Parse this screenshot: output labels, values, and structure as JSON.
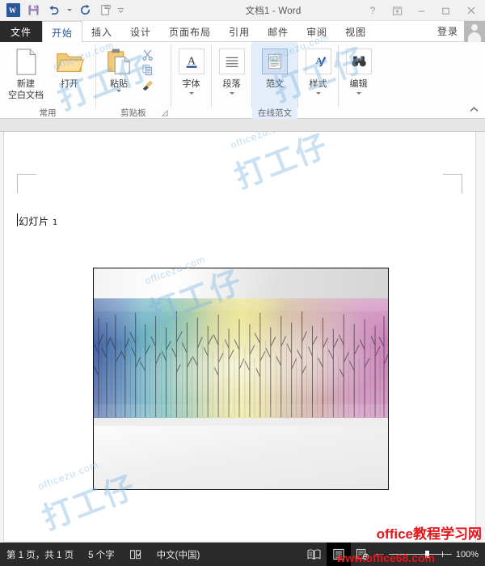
{
  "window": {
    "title": "文档1 - Word",
    "quick_access": [
      {
        "name": "word-logo",
        "label": "W"
      },
      {
        "name": "save",
        "label": "保存"
      },
      {
        "name": "undo",
        "label": "撤消"
      },
      {
        "name": "undo-dropdown",
        "label": ""
      },
      {
        "name": "redo",
        "label": "重复"
      },
      {
        "name": "touch-mode",
        "label": "触摸/鼠标模式"
      },
      {
        "name": "customize-qat",
        "label": ""
      }
    ],
    "controls": {
      "help": "?",
      "ribbon_display": "ribbon-display-options",
      "minimize": "—",
      "restore": "❐",
      "close": "✕"
    }
  },
  "tabs": {
    "file": "文件",
    "items": [
      {
        "label": "开始",
        "active": true
      },
      {
        "label": "插入",
        "active": false
      },
      {
        "label": "设计",
        "active": false
      },
      {
        "label": "页面布局",
        "active": false
      },
      {
        "label": "引用",
        "active": false
      },
      {
        "label": "邮件",
        "active": false
      },
      {
        "label": "审阅",
        "active": false
      },
      {
        "label": "视图",
        "active": false
      }
    ],
    "sign_in": "登录"
  },
  "ribbon": {
    "groups": [
      {
        "label": "常用",
        "buttons": [
          {
            "name": "new-blank-document",
            "label": "新建",
            "label2": "空白文档",
            "icon": "page-icon"
          },
          {
            "name": "open",
            "label": "打开",
            "label2": "",
            "icon": "folder-icon"
          }
        ]
      },
      {
        "label": "剪贴板",
        "has_launcher": true,
        "buttons": [
          {
            "name": "paste",
            "label": "粘贴",
            "label2": "",
            "icon": "clipboard-icon",
            "dropdown": true
          },
          {
            "name": "cut",
            "label": "",
            "label2": "",
            "icon": "scissors-icon"
          },
          {
            "name": "copy",
            "label": "",
            "label2": "",
            "icon": "copy-icon"
          },
          {
            "name": "format-painter",
            "label": "",
            "label2": "",
            "icon": "paintbrush-icon"
          }
        ]
      },
      {
        "label": "",
        "buttons": [
          {
            "name": "font",
            "label": "字体",
            "label2": "",
            "icon": "font-a-icon",
            "dropdown": true
          }
        ]
      },
      {
        "label": "",
        "buttons": [
          {
            "name": "paragraph",
            "label": "段落",
            "label2": "",
            "icon": "paragraph-lines-icon",
            "dropdown": true
          }
        ]
      },
      {
        "label": "在线范文",
        "selected": true,
        "buttons": [
          {
            "name": "sample-text",
            "label": "范文",
            "label2": "",
            "icon": "document-picture-icon",
            "selected": true
          }
        ]
      },
      {
        "label": "",
        "buttons": [
          {
            "name": "styles",
            "label": "样式",
            "label2": "",
            "icon": "style-a-brush-icon",
            "dropdown": true
          }
        ]
      },
      {
        "label": "",
        "buttons": [
          {
            "name": "editing",
            "label": "编辑",
            "label2": "",
            "icon": "binoculars-icon",
            "dropdown": true
          }
        ]
      }
    ],
    "collapse_label": "折叠功能区"
  },
  "document": {
    "text": "幻灯片",
    "text_number": "1",
    "picture": {
      "name": "rainbow-forest-picture",
      "description": "彩虹渐变树林图片"
    }
  },
  "status_bar": {
    "page_info": "第 1 页，共 1 页",
    "word_count": "5 个字",
    "proofing_icon": "proofing-icon",
    "language": "中文(中国)",
    "views": [
      {
        "name": "read-mode",
        "active": false
      },
      {
        "name": "print-layout",
        "active": true
      },
      {
        "name": "web-layout",
        "active": false
      }
    ],
    "zoom_out": "－",
    "zoom_in": "＋",
    "zoom_level": "100%"
  },
  "watermarks": {
    "site_name_cn": "office教程学习网",
    "site_url": "www.office68.com",
    "overlay_small": "officezu.com",
    "overlay_big": "打工仔"
  },
  "colors": {
    "accent": "#2b579a",
    "file_tab": "#2b2b2b",
    "status_bar": "#2b2b2b",
    "selected_ribbon_button": "#cfe0f5",
    "brand_red": "#e5161b"
  }
}
